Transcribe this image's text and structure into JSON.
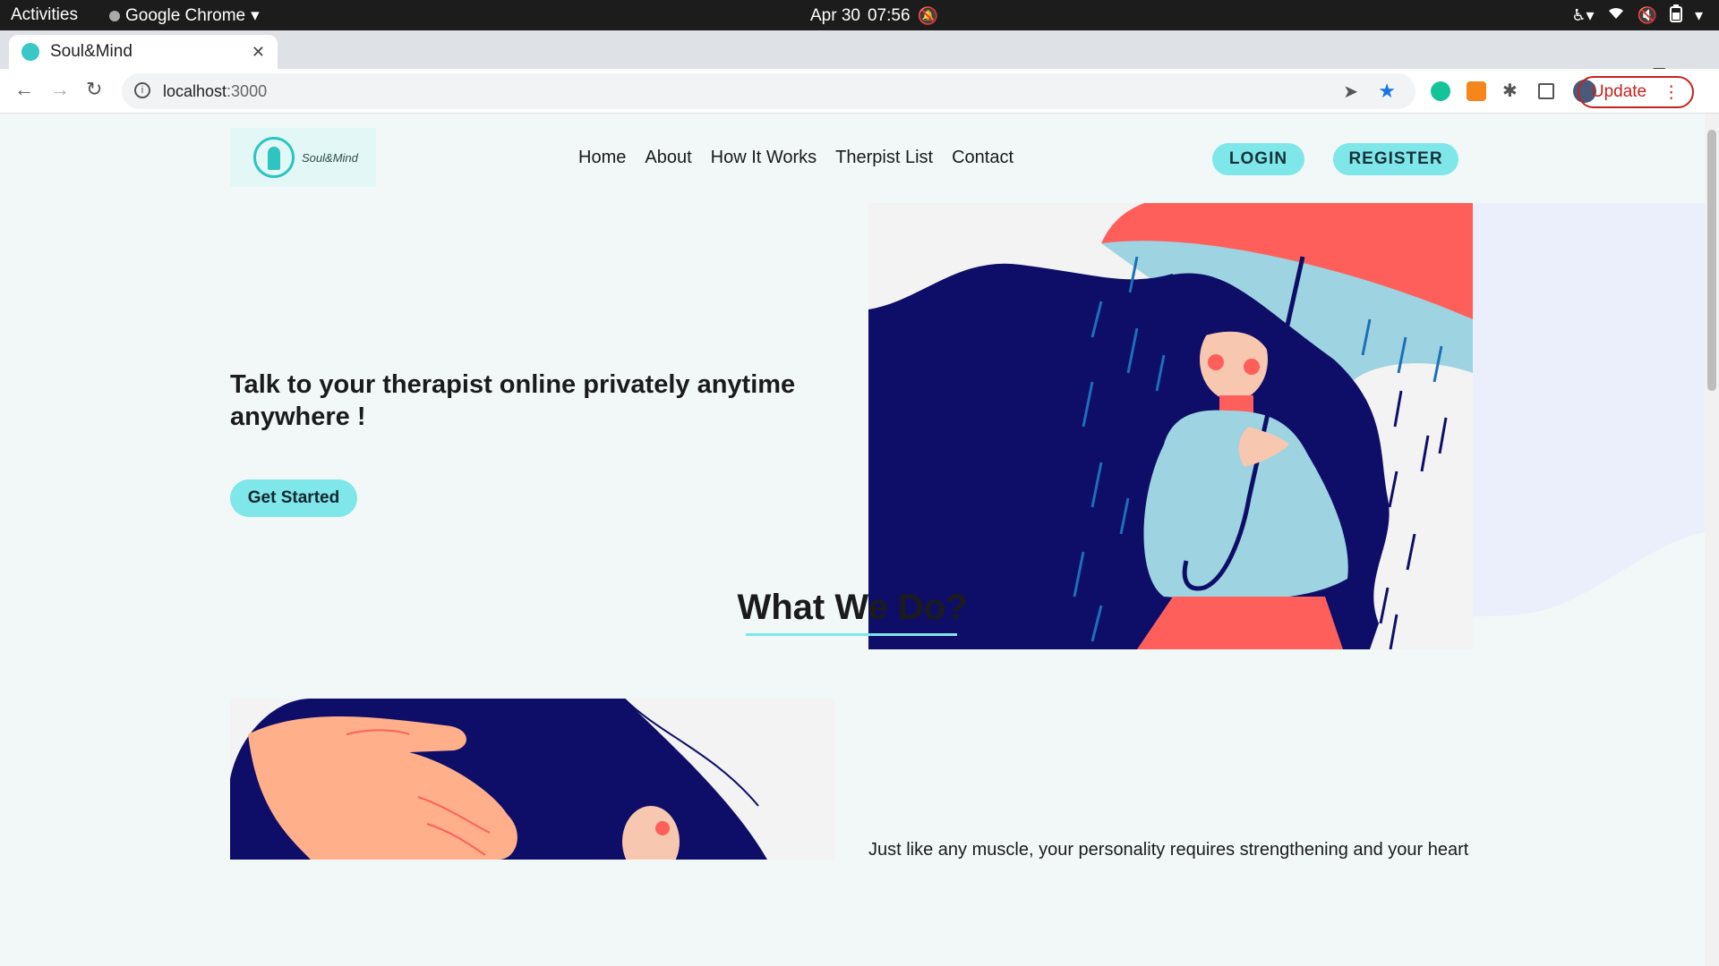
{
  "system_bar": {
    "activities": "Activities",
    "app_name": "Google Chrome",
    "date": "Apr 30",
    "time": "07:56"
  },
  "browser": {
    "tab_title": "Soul&Mind",
    "url_host": "localhost",
    "url_port": ":3000",
    "update_label": "Update"
  },
  "site": {
    "logo_text": "Soul&Mind",
    "nav": [
      "Home",
      "About",
      "How It Works",
      "Therpist List",
      "Contact"
    ],
    "login_label": "LOGIN",
    "register_label": "REGISTER",
    "hero_title": "Talk to your therapist online privately anytime anywhere !",
    "cta_label": "Get Started",
    "section_title": "What We Do?",
    "section_text": "Just like any muscle, your personality requires strengthening and your heart"
  },
  "colors": {
    "accent": "#7fe6ea",
    "navy": "#0e0e68",
    "coral": "#fe5f5b",
    "sky": "#9ed3e1",
    "page_bg": "#f2f8f8"
  },
  "icons": [
    "accessibility-icon",
    "wifi-icon",
    "volume-icon",
    "battery-icon",
    "back-icon",
    "forward-icon",
    "reload-icon",
    "info-icon",
    "send-icon",
    "star-icon",
    "grammarly-icon",
    "metamask-icon",
    "extensions-icon",
    "sidepanel-icon",
    "profile-icon",
    "chevron-down-icon"
  ]
}
